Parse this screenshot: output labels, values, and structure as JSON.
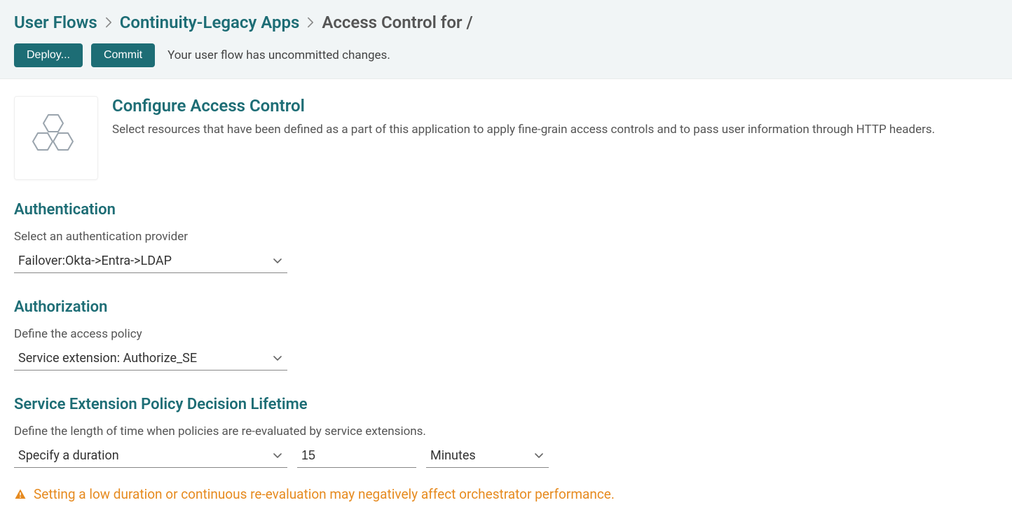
{
  "breadcrumb": {
    "items": [
      {
        "label": "User Flows",
        "link": true
      },
      {
        "label": "Continuity-Legacy Apps",
        "link": true
      },
      {
        "label": "Access Control for /",
        "link": false
      }
    ]
  },
  "actions": {
    "deploy_label": "Deploy...",
    "commit_label": "Commit",
    "status_text": "Your user flow has uncommitted changes."
  },
  "intro": {
    "title": "Configure Access Control",
    "description": "Select resources that have been defined as a part of this application to apply fine-grain access controls and to pass user information through HTTP headers."
  },
  "sections": {
    "authentication": {
      "heading": "Authentication",
      "label": "Select an authentication provider",
      "value": "Failover:Okta->Entra->LDAP"
    },
    "authorization": {
      "heading": "Authorization",
      "label": "Define the access policy",
      "value": "Service extension: Authorize_SE"
    },
    "lifetime": {
      "heading": "Service Extension Policy Decision Lifetime",
      "label": "Define the length of time when policies are re-evaluated by service extensions.",
      "mode_value": "Specify a duration",
      "amount_value": "15",
      "unit_value": "Minutes"
    }
  },
  "warning": {
    "text": "Setting a low duration or continuous re-evaluation may negatively affect orchestrator performance."
  }
}
